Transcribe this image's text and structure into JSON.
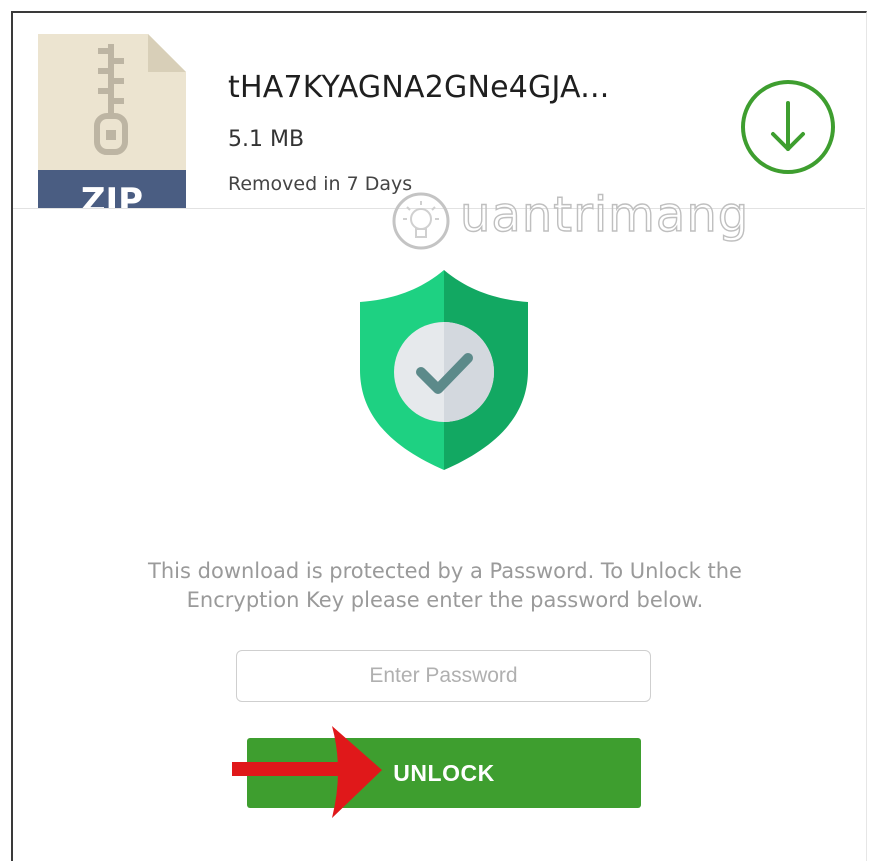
{
  "file": {
    "type_label": "ZIP",
    "name": "tHA7KYAGNA2GNe4GJA...",
    "size": "5.1 MB",
    "expiry": "Removed in 7 Days"
  },
  "watermark": {
    "text": "uantrimang"
  },
  "security": {
    "message_line1": "This download is protected by a Password. To Unlock the",
    "message_line2": "Encryption Key please enter the password below."
  },
  "password": {
    "placeholder": "Enter Password",
    "value": ""
  },
  "unlock": {
    "label": "UNLOCK"
  },
  "icons": {
    "file": "zip-file-icon",
    "download": "download-arrow-icon",
    "shield": "shield-check-icon",
    "annotation": "red-arrow-icon"
  },
  "colors": {
    "accent_green": "#3e9e2f",
    "shield_light": "#1ed182",
    "shield_dark": "#12a862",
    "zip_band": "#4a5d82",
    "file_paper": "#ece4d0",
    "annotation_red": "#e0181a"
  }
}
